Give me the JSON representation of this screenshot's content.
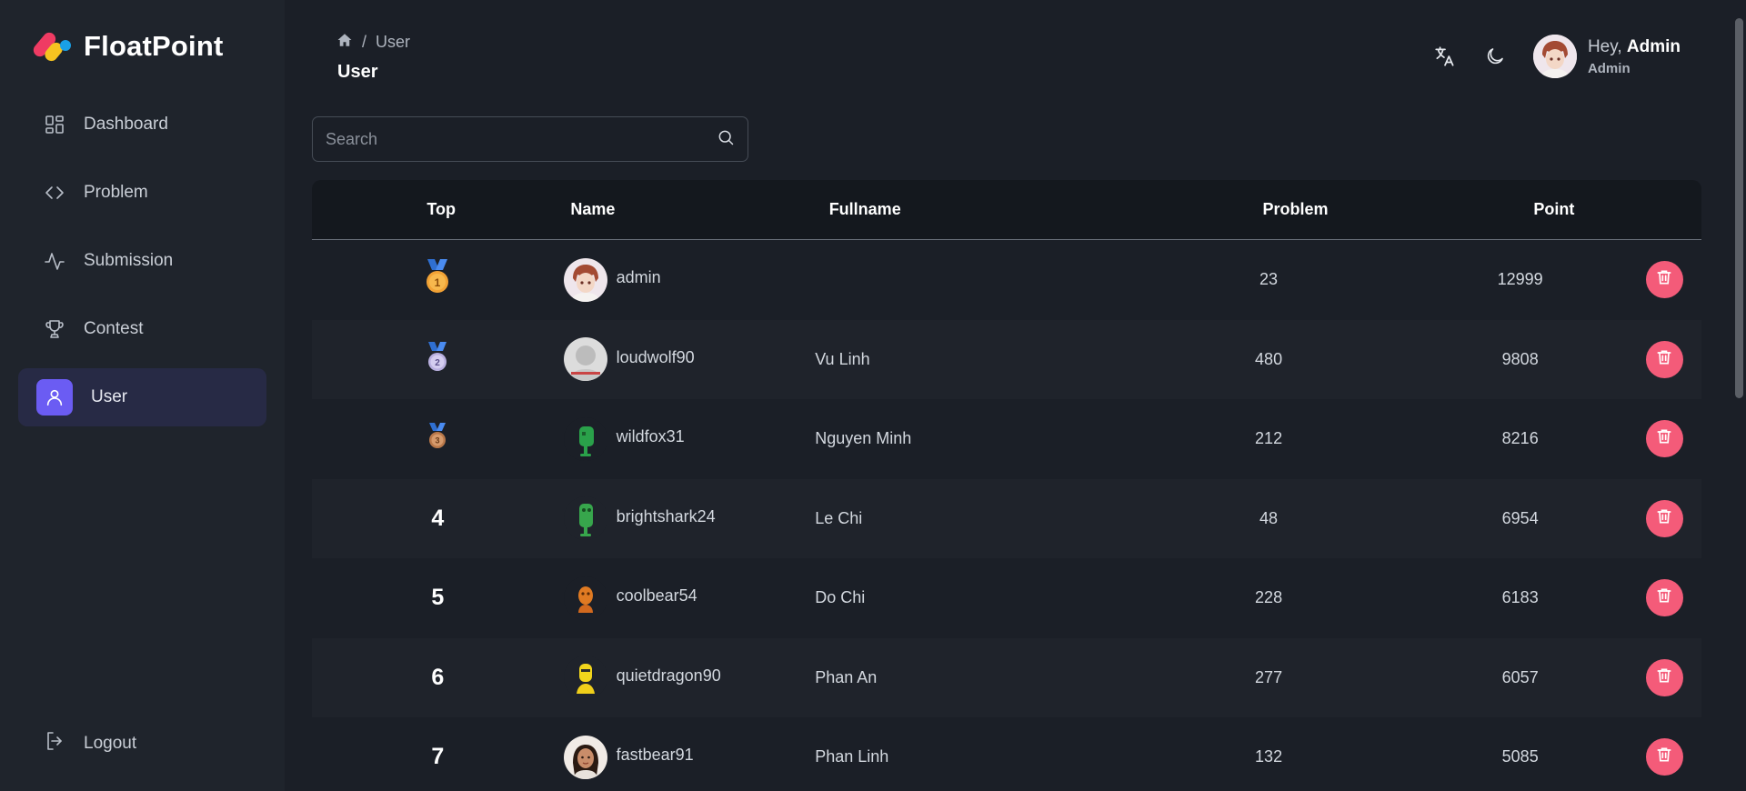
{
  "app": {
    "name": "FloatPoint"
  },
  "sidebar": {
    "items": [
      {
        "label": "Dashboard",
        "icon": "dashboard-icon"
      },
      {
        "label": "Problem",
        "icon": "code-icon"
      },
      {
        "label": "Submission",
        "icon": "activity-icon"
      },
      {
        "label": "Contest",
        "icon": "trophy-icon"
      },
      {
        "label": "User",
        "icon": "user-icon",
        "active": true
      }
    ],
    "logout_label": "Logout"
  },
  "breadcrumb": {
    "separator": "/",
    "current": "User"
  },
  "page": {
    "title": "User"
  },
  "topbar": {
    "greeting": "Hey,",
    "username": "Admin",
    "role": "Admin"
  },
  "search": {
    "placeholder": "Search",
    "value": ""
  },
  "table": {
    "columns": {
      "top": "Top",
      "name": "Name",
      "fullname": "Fullname",
      "problem": "Problem",
      "point": "Point"
    },
    "rows": [
      {
        "top": "1",
        "name": "admin",
        "fullname": "",
        "problem": "23",
        "point": "12999"
      },
      {
        "top": "2",
        "name": "loudwolf90",
        "fullname": "Vu Linh",
        "problem": "480",
        "point": "9808"
      },
      {
        "top": "3",
        "name": "wildfox31",
        "fullname": "Nguyen Minh",
        "problem": "212",
        "point": "8216"
      },
      {
        "top": "4",
        "name": "brightshark24",
        "fullname": "Le Chi",
        "problem": "48",
        "point": "6954"
      },
      {
        "top": "5",
        "name": "coolbear54",
        "fullname": "Do Chi",
        "problem": "228",
        "point": "6183"
      },
      {
        "top": "6",
        "name": "quietdragon90",
        "fullname": "Phan An",
        "problem": "277",
        "point": "6057"
      },
      {
        "top": "7",
        "name": "fastbear91",
        "fullname": "Phan Linh",
        "problem": "132",
        "point": "5085"
      }
    ]
  },
  "colors": {
    "accent": "#6b5cf3",
    "delete": "#f45b79",
    "gold": "#f4a93a",
    "silver": "#c9c3e8",
    "bronze": "#c98a5a"
  }
}
